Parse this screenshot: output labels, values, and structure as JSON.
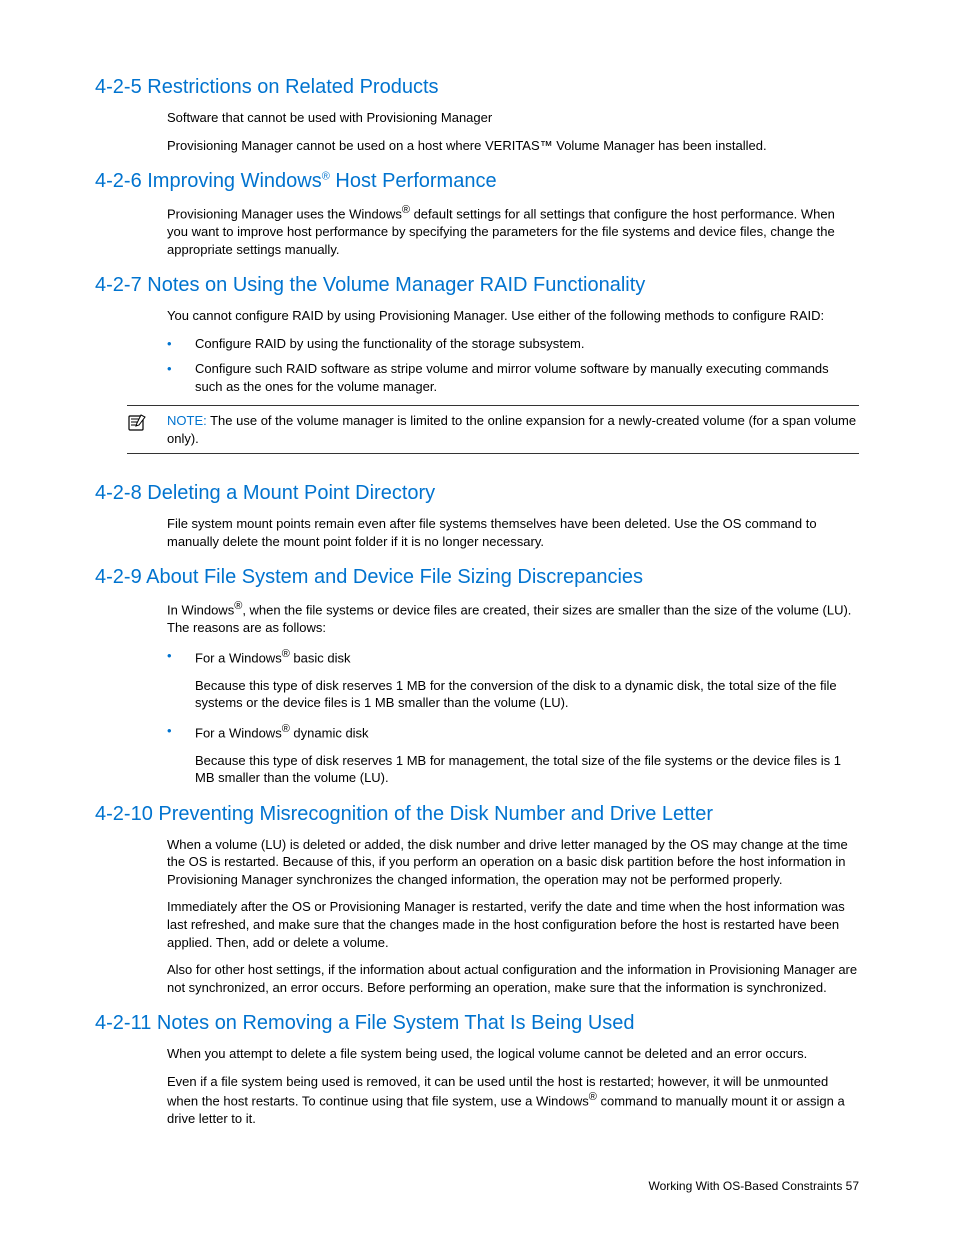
{
  "sections": {
    "s425": {
      "heading": "4-2-5 Restrictions on Related Products",
      "p1": "Software that cannot be used with Provisioning Manager",
      "p2": "Provisioning Manager cannot be used on a host where VERITAS™ Volume Manager has been installed."
    },
    "s426": {
      "heading_a": "4-2-6 Improving Windows",
      "heading_b": " Host Performance",
      "p1a": "Provisioning Manager uses the Windows",
      "p1b": " default settings for all settings that configure the host performance. When you want to improve host performance by specifying the parameters for the file systems and device files, change the appropriate settings manually."
    },
    "s427": {
      "heading": "4-2-7 Notes on Using the Volume Manager RAID Functionality",
      "p1": " You cannot configure RAID by using Provisioning Manager. Use either of the following methods to configure RAID:",
      "li1": "Configure RAID by using the functionality of the storage subsystem.",
      "li2": "Configure such RAID software as stripe volume and mirror volume software by manually executing commands such as the ones for the volume manager.",
      "note_label": "NOTE:  ",
      "note_text": "The use of the volume manager is limited to the online expansion for a newly-created volume (for a span volume only)."
    },
    "s428": {
      "heading": "4-2-8 Deleting a Mount Point Directory",
      "p1": "File system mount points remain even after file systems themselves have been deleted. Use the OS command to manually delete the mount point folder if it is no longer necessary."
    },
    "s429": {
      "heading": "4-2-9 About File System and Device File Sizing Discrepancies",
      "p1a": "In Windows",
      "p1b": ", when the file systems or device files are created, their sizes are smaller than the size of the volume (LU). The reasons are as follows:",
      "li1a": "For a Windows",
      "li1b": " basic disk",
      "li1_desc": "Because this type of disk reserves 1 MB for the conversion of the disk to a dynamic disk, the total size of the file systems or the device files is 1 MB smaller than the volume (LU).",
      "li2a": "For a Windows",
      "li2b": " dynamic disk",
      "li2_desc": "Because this type of disk reserves 1 MB for management, the total size of the file systems or the device files is 1 MB smaller than the volume (LU)."
    },
    "s4210": {
      "heading": "4-2-10 Preventing Misrecognition of the Disk Number and Drive Letter",
      "p1": "When a volume (LU) is deleted or added, the disk number and drive letter managed by the OS may change at the time the OS is restarted. Because of this, if you perform an operation on a basic disk partition before the host information in Provisioning Manager synchronizes the changed information, the operation may not be performed properly.",
      "p2": "Immediately after the OS or Provisioning Manager is restarted, verify the date and time when the host information was last refreshed, and make sure that the changes made in the host configuration before the host is restarted have been applied. Then, add or delete a volume.",
      "p3": "Also for other host settings, if the information about actual configuration and the information in Provisioning Manager are not synchronized, an error occurs. Before performing an operation, make sure that the information is synchronized."
    },
    "s4211": {
      "heading": "4-2-11 Notes on Removing a File System That Is Being Used",
      "p1": "When you attempt to delete a file system being used, the logical volume cannot be deleted and an error occurs.",
      "p2a": "Even if a file system being used is removed, it can be used until the host is restarted; however, it will be unmounted when the host restarts. To continue using that file system, use a Windows",
      "p2b": " command to manually mount it or assign a drive letter to it."
    }
  },
  "footer": "Working With OS-Based Constraints  57",
  "reg": "®"
}
